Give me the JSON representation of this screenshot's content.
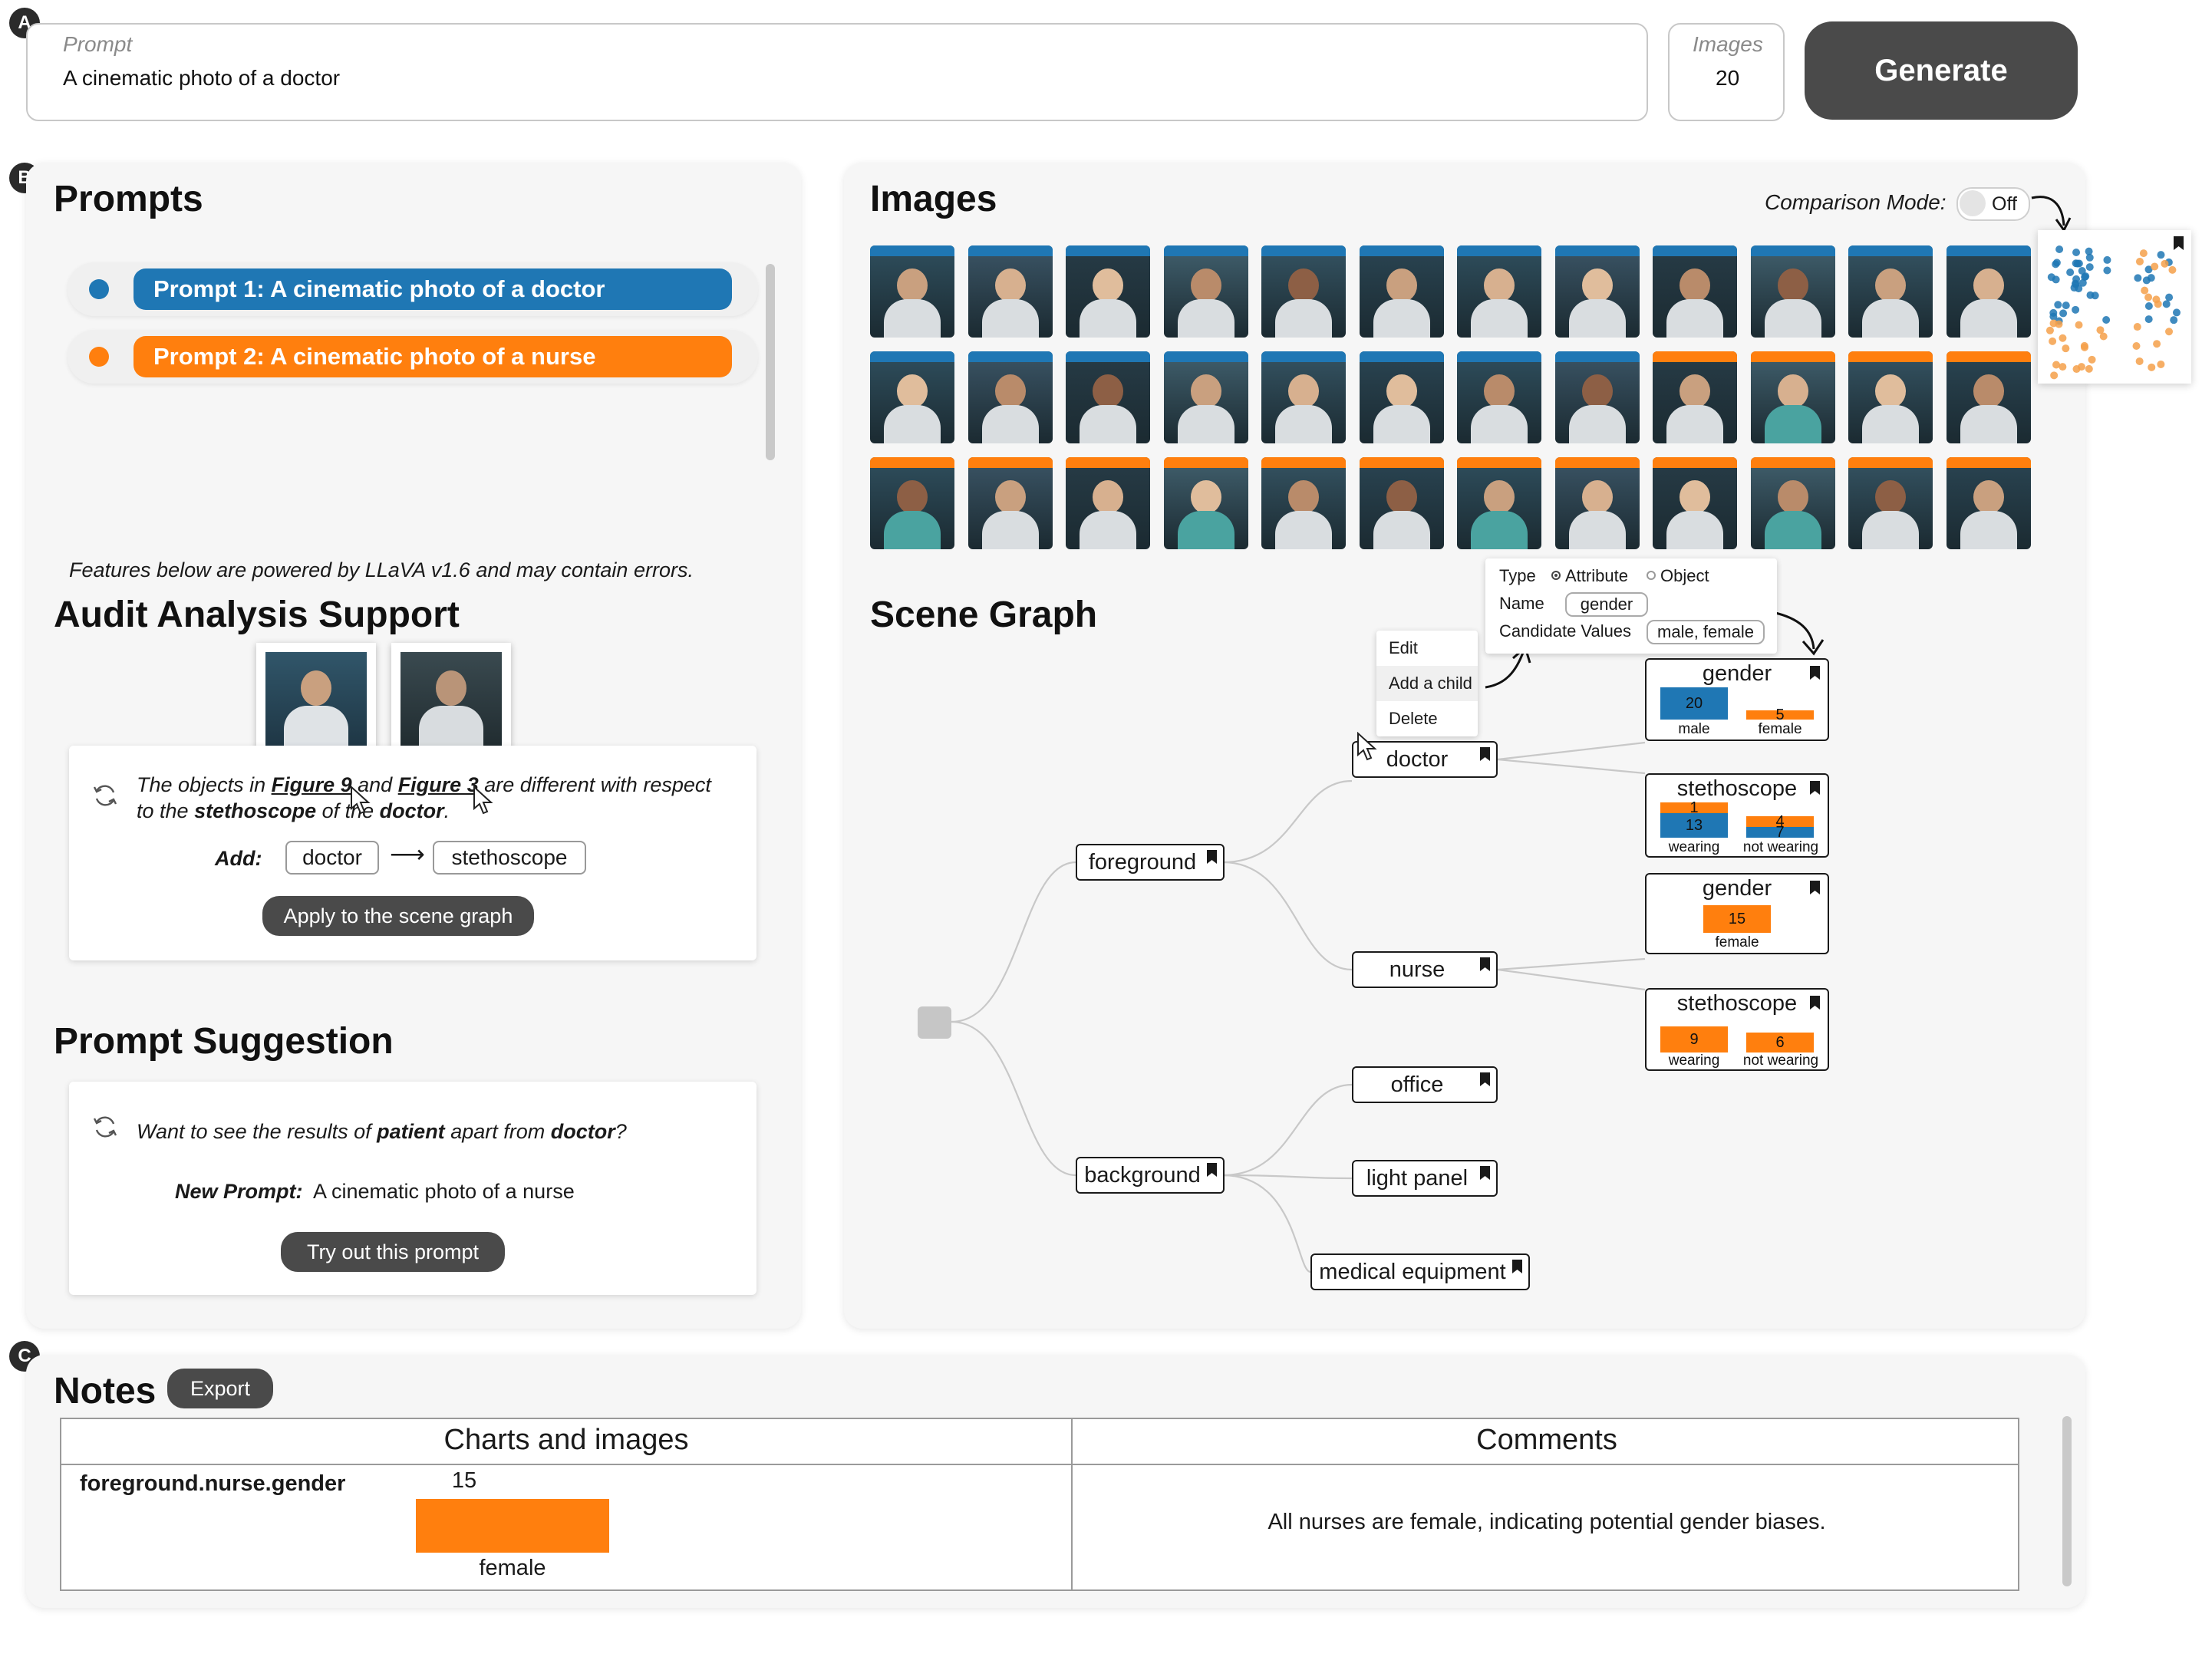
{
  "badges": {
    "a": "A",
    "b": "B",
    "c": "C"
  },
  "top_bar": {
    "prompt_label": "Prompt",
    "prompt_value": "A cinematic photo of a doctor",
    "images_label": "Images",
    "images_value": "20",
    "generate_label": "Generate"
  },
  "prompts_panel": {
    "title": "Prompts",
    "items": [
      {
        "label": "Prompt 1: A cinematic photo of a doctor",
        "color": "#1f77b4"
      },
      {
        "label": "Prompt 2: A cinematic photo of a nurse",
        "color": "#ff7f0e"
      }
    ],
    "llava_note": "Features below are powered by LLaVA v1.6 and may contain errors."
  },
  "audit": {
    "title": "Audit Analysis Support",
    "text_pre": "The objects in ",
    "fig_a": "Figure 9",
    "text_mid": " and ",
    "fig_b": "Figure 3",
    "text_post": " are different with respect",
    "line2_pre": "to the ",
    "line2_obj": "stethoscope",
    "line2_mid": " of the ",
    "line2_subj": "doctor",
    "line2_end": ".",
    "add_label": "Add:",
    "from_chip": "doctor",
    "arrow": "⟶",
    "to_chip": "stethoscope",
    "apply_button": "Apply to the scene graph"
  },
  "suggestion": {
    "title": "Prompt Suggestion",
    "q_pre": "Want to see the results of ",
    "q_obj": "patient",
    "q_mid": " apart from ",
    "q_subj": "doctor",
    "q_end": "?",
    "new_prompt_label": "New Prompt:",
    "new_prompt_value": "A cinematic photo of a nurse",
    "try_button": "Try out this prompt"
  },
  "images_panel": {
    "title": "Images",
    "comparison_label": "Comparison Mode:",
    "toggle_value": "Off"
  },
  "scene_graph": {
    "title": "Scene Graph",
    "context_menu": [
      "Edit",
      "Add a child",
      "Delete"
    ],
    "attr_form": {
      "type_label": "Type",
      "type_attr": "Attribute",
      "type_obj": "Object",
      "name_label": "Name",
      "name_value": "gender",
      "cand_label": "Candidate Values",
      "cand_value": "male, female"
    },
    "nodes": {
      "doctor": "doctor",
      "foreground": "foreground",
      "nurse": "nurse",
      "background": "background",
      "office": "office",
      "light_panel": "light panel",
      "medical_equipment": "medical equipment"
    },
    "attrs": {
      "doctor_gender": {
        "title": "gender",
        "male": "20",
        "female": "5",
        "male_label": "male",
        "female_label": "female"
      },
      "doctor_steth": {
        "title": "stethoscope",
        "w_orange": "1",
        "w_blue": "13",
        "nw_orange": "4",
        "nw_blue": "7",
        "w_label": "wearing",
        "nw_label": "not wearing"
      },
      "nurse_gender": {
        "title": "gender",
        "female": "15",
        "female_label": "female"
      },
      "nurse_steth": {
        "title": "stethoscope",
        "w": "9",
        "nw": "6",
        "w_label": "wearing",
        "nw_label": "not wearing"
      }
    }
  },
  "notes": {
    "title": "Notes",
    "export_button": "Export",
    "col_charts": "Charts and images",
    "col_comments": "Comments",
    "row_key": "foreground.nurse.gender",
    "row_value": "15",
    "row_bar_label": "female",
    "row_comment": "All nurses are female, indicating potential gender biases."
  },
  "colors": {
    "blue": "#1f77b4",
    "orange": "#ff7f0e",
    "dark_button": "#4a4a4a"
  }
}
